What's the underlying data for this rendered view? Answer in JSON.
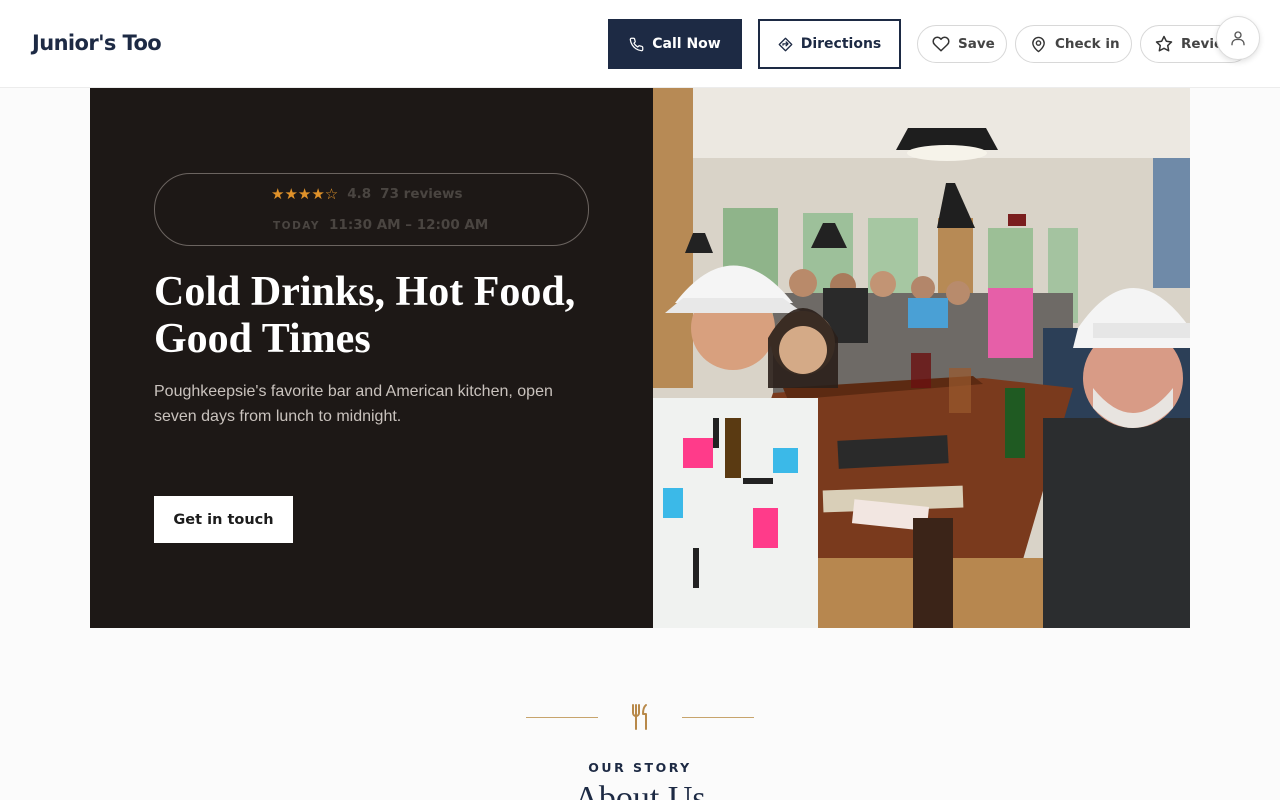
{
  "header": {
    "brand": "Junior's Too",
    "call_label": "Call Now",
    "directions_label": "Directions",
    "save_label": "Save",
    "checkin_label": "Check in",
    "review_label": "Review"
  },
  "hero": {
    "stars": "★★★★☆",
    "rating": "4.8",
    "reviews": "73 reviews",
    "today_label": "TODAY",
    "hours": "11:30 AM – 12:00 AM",
    "title": "Cold Drinks, Hot Food, Good Times",
    "subtitle": "Poughkeepsie's favorite bar and American kitchen, open seven days from lunch to midnight.",
    "cta_label": "Get in touch"
  },
  "about": {
    "eyebrow": "OUR STORY",
    "title": "About Us"
  },
  "colors": {
    "navy": "#1d2a44",
    "hero_bg": "#1d1816",
    "star": "#e0922a",
    "accent_gold": "#c7a46c"
  },
  "icons": [
    "phone-icon",
    "directions-icon",
    "heart-icon",
    "map-pin-icon",
    "star-icon",
    "user-icon",
    "utensils-icon"
  ]
}
